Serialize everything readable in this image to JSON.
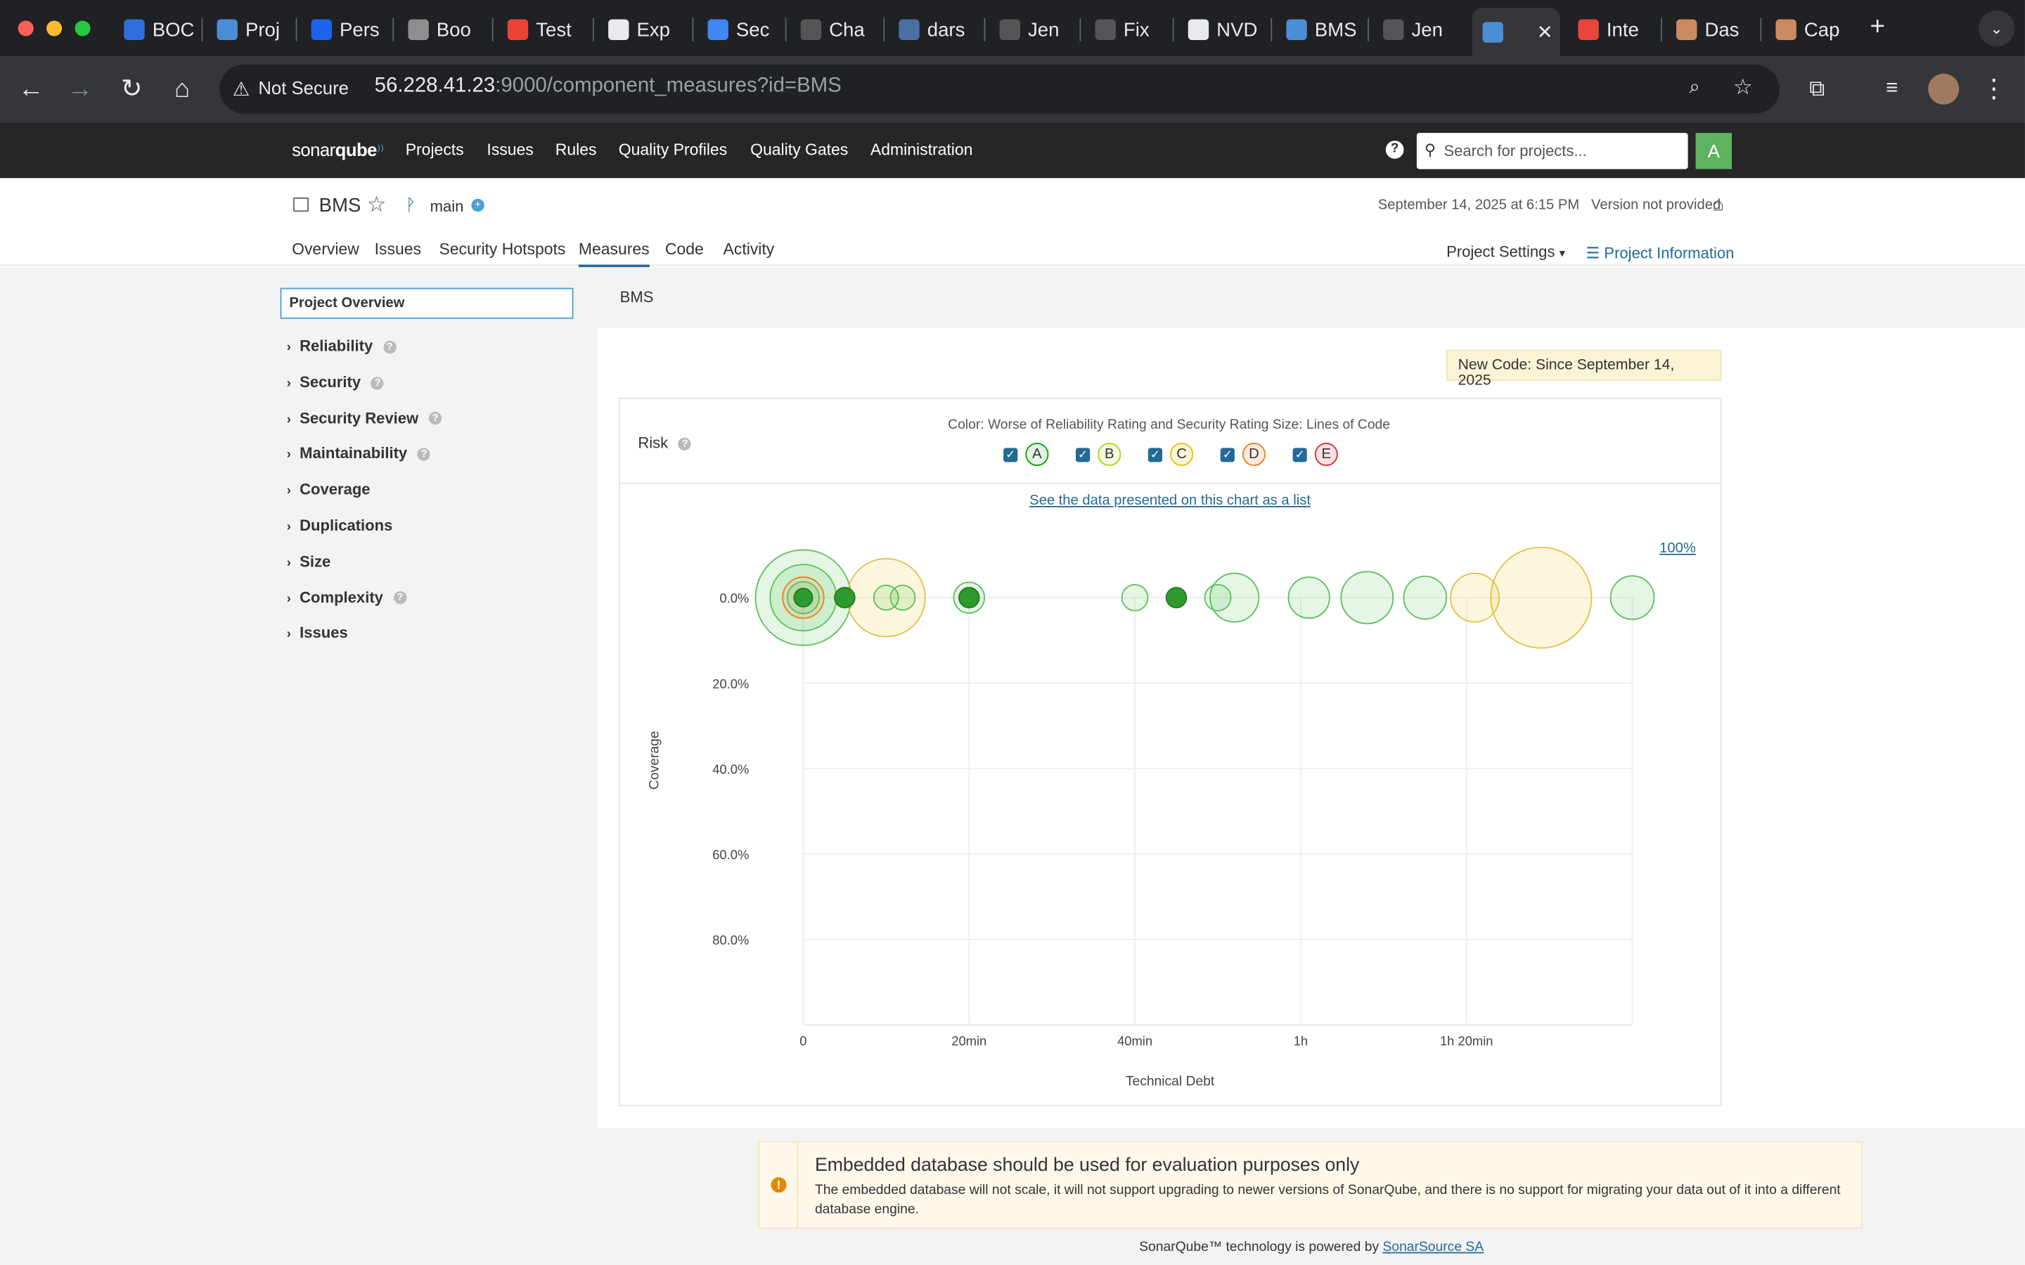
{
  "browser": {
    "tabs": [
      {
        "title": "BOC",
        "color": "#2f6fdb"
      },
      {
        "title": "Proj",
        "color": "#4b8ed6"
      },
      {
        "title": "Pers",
        "color": "#1d63ed"
      },
      {
        "title": "Boo",
        "color": "#8e8e8e"
      },
      {
        "title": "Test",
        "color": "#ea4335"
      },
      {
        "title": "Exp",
        "color": "#e8eaed"
      },
      {
        "title": "Sec",
        "color": "#4285f4"
      },
      {
        "title": "Cha",
        "color": "#555555"
      },
      {
        "title": "dars",
        "color": "#4a6fa5"
      },
      {
        "title": "Jen",
        "color": "#555555"
      },
      {
        "title": "Fix",
        "color": "#555555"
      },
      {
        "title": "NVD",
        "color": "#e8eaed"
      },
      {
        "title": "BMS",
        "color": "#4b8ed6"
      },
      {
        "title": "Jen",
        "color": "#555555"
      },
      {
        "title": "",
        "color": "#4b8ed6",
        "active": true
      },
      {
        "title": "Inte",
        "color": "#e8453c"
      },
      {
        "title": "Das",
        "color": "#c98b5f"
      },
      {
        "title": "Cap",
        "color": "#c98b5f"
      }
    ],
    "security_label": "Not Secure",
    "url_host": "56.228.41.23",
    "url_path": ":9000/component_measures?id=BMS"
  },
  "sonar": {
    "logo_bold": "sonar",
    "logo_rest": "qube",
    "menu": [
      "Projects",
      "Issues",
      "Rules",
      "Quality Profiles",
      "Quality Gates",
      "Administration"
    ],
    "search_placeholder": "Search for projects...",
    "avatar_letter": "A"
  },
  "project": {
    "name": "BMS",
    "branch": "main",
    "date": "September 14, 2025 at 6:15 PM",
    "version": "Version not provided",
    "tabs": [
      "Overview",
      "Issues",
      "Security Hotspots",
      "Measures",
      "Code",
      "Activity"
    ],
    "active_tab": "Measures",
    "settings_label": "Project Settings",
    "info_label": "Project Information"
  },
  "sidebar": {
    "overview_label": "Project Overview",
    "items": [
      {
        "label": "Reliability",
        "help": true
      },
      {
        "label": "Security",
        "help": true
      },
      {
        "label": "Security Review",
        "help": true
      },
      {
        "label": "Maintainability",
        "help": true
      },
      {
        "label": "Coverage",
        "help": false
      },
      {
        "label": "Duplications",
        "help": false
      },
      {
        "label": "Size",
        "help": false
      },
      {
        "label": "Complexity",
        "help": true
      },
      {
        "label": "Issues",
        "help": false
      }
    ]
  },
  "main": {
    "title": "BMS",
    "new_code": "New Code: Since September 14, 2025",
    "risk_label": "Risk",
    "color_size_label": "Color: Worse of Reliability Rating and Security Rating  Size: Lines of Code",
    "ratings": [
      {
        "letter": "A",
        "color": "#00aa00",
        "fill": "#e6f4e6"
      },
      {
        "letter": "B",
        "color": "#b0d513",
        "fill": "#f4f9e0"
      },
      {
        "letter": "C",
        "color": "#eabe06",
        "fill": "#fcf5da"
      },
      {
        "letter": "D",
        "color": "#ed7d20",
        "fill": "#fcecdf"
      },
      {
        "letter": "E",
        "color": "#d02f3a",
        "fill": "#f9e0e2"
      }
    ],
    "see_list_link": "See the data presented on this chart as a list",
    "zoom_label": "100%"
  },
  "chart_data": {
    "type": "scatter",
    "xlabel": "Technical Debt",
    "ylabel": "Coverage",
    "x_unit": "minutes",
    "xlim": [
      0,
      100
    ],
    "ylim": [
      0,
      100
    ],
    "y_reversed": true,
    "x_ticks": [
      {
        "v": 0,
        "label": "0"
      },
      {
        "v": 20,
        "label": "20min"
      },
      {
        "v": 40,
        "label": "40min"
      },
      {
        "v": 60,
        "label": "1h"
      },
      {
        "v": 80,
        "label": "1h 20min"
      }
    ],
    "y_ticks": [
      {
        "v": 0,
        "label": "0.0%"
      },
      {
        "v": 20,
        "label": "20.0%"
      },
      {
        "v": 40,
        "label": "40.0%"
      },
      {
        "v": 60,
        "label": "60.0%"
      },
      {
        "v": 80,
        "label": "80.0%"
      }
    ],
    "points": [
      {
        "x": 0,
        "y": 0,
        "size": 1350,
        "rating": "A"
      },
      {
        "x": 0,
        "y": 0,
        "size": 650,
        "rating": "A"
      },
      {
        "x": 0,
        "y": 0,
        "size": 250,
        "rating": "D"
      },
      {
        "x": 0,
        "y": 0,
        "size": 150,
        "rating": "A"
      },
      {
        "x": 0,
        "y": 0,
        "size": 50,
        "rating": "A"
      },
      {
        "x": 5,
        "y": 0,
        "size": 60,
        "rating": "A"
      },
      {
        "x": 10,
        "y": 0,
        "size": 900,
        "rating": "C"
      },
      {
        "x": 10,
        "y": 0,
        "size": 90,
        "rating": "A"
      },
      {
        "x": 12,
        "y": 0,
        "size": 90,
        "rating": "A"
      },
      {
        "x": 20,
        "y": 0,
        "size": 140,
        "rating": "A"
      },
      {
        "x": 20,
        "y": 0,
        "size": 60,
        "rating": "A"
      },
      {
        "x": 40,
        "y": 0,
        "size": 100,
        "rating": "A"
      },
      {
        "x": 45,
        "y": 0,
        "size": 60,
        "rating": "A"
      },
      {
        "x": 50,
        "y": 0,
        "size": 100,
        "rating": "A"
      },
      {
        "x": 52,
        "y": 0,
        "size": 350,
        "rating": "A"
      },
      {
        "x": 61,
        "y": 0,
        "size": 250,
        "rating": "A"
      },
      {
        "x": 68,
        "y": 0,
        "size": 400,
        "rating": "A"
      },
      {
        "x": 75,
        "y": 0,
        "size": 270,
        "rating": "A"
      },
      {
        "x": 81,
        "y": 0,
        "size": 350,
        "rating": "C"
      },
      {
        "x": 89,
        "y": 0,
        "size": 1500,
        "rating": "C"
      },
      {
        "x": 100,
        "y": 0,
        "size": 280,
        "rating": "A"
      }
    ]
  },
  "warning": {
    "title": "Embedded database should be used for evaluation purposes only",
    "text": "The embedded database will not scale, it will not support upgrading to newer versions of SonarQube, and there is no support for migrating your data out of it into a different database engine."
  },
  "footer": {
    "text": "SonarQube™ technology is powered by",
    "link": "SonarSource SA"
  }
}
